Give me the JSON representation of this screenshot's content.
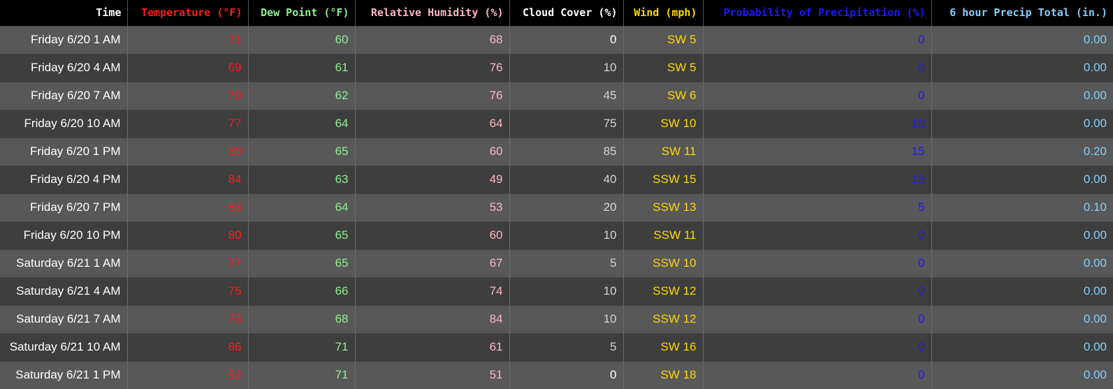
{
  "table": {
    "headers": {
      "time": "Time",
      "temperature": "Temperature (°F)",
      "dew_point": "Dew Point (°F)",
      "humidity": "Relative Humidity (%)",
      "cloud_cover": "Cloud Cover (%)",
      "wind": "Wind (mph)",
      "pop": "Probability of Precipitation (%)",
      "precip": "6 hour Precip Total (in.)"
    },
    "colors": {
      "time": "#ffffff",
      "temperature": "#ff1a1a",
      "dew_point": "#90ee90",
      "humidity": "#ffb6c1",
      "cloud_cover": "#d3d3d3",
      "wind": "#ffd700",
      "pop": "#1a1aff",
      "precip": "#87cefa"
    },
    "rows": [
      {
        "time": "Friday 6/20 1 AM",
        "temperature": "71",
        "dew_point": "60",
        "humidity": "68",
        "cloud_cover": "0",
        "wind": "SW 5",
        "pop": "0",
        "precip": "0.00"
      },
      {
        "time": "Friday 6/20 4 AM",
        "temperature": "69",
        "dew_point": "61",
        "humidity": "76",
        "cloud_cover": "10",
        "wind": "SW 5",
        "pop": "0",
        "precip": "0.00"
      },
      {
        "time": "Friday 6/20 7 AM",
        "temperature": "70",
        "dew_point": "62",
        "humidity": "76",
        "cloud_cover": "45",
        "wind": "SW 6",
        "pop": "0",
        "precip": "0.00"
      },
      {
        "time": "Friday 6/20 10 AM",
        "temperature": "77",
        "dew_point": "64",
        "humidity": "64",
        "cloud_cover": "75",
        "wind": "SW 10",
        "pop": "10",
        "precip": "0.00"
      },
      {
        "time": "Friday 6/20 1 PM",
        "temperature": "80",
        "dew_point": "65",
        "humidity": "60",
        "cloud_cover": "85",
        "wind": "SW 11",
        "pop": "15",
        "precip": "0.20"
      },
      {
        "time": "Friday 6/20 4 PM",
        "temperature": "84",
        "dew_point": "63",
        "humidity": "49",
        "cloud_cover": "40",
        "wind": "SSW 15",
        "pop": "18",
        "precip": "0.00"
      },
      {
        "time": "Friday 6/20 7 PM",
        "temperature": "83",
        "dew_point": "64",
        "humidity": "53",
        "cloud_cover": "20",
        "wind": "SSW 13",
        "pop": "5",
        "precip": "0.10"
      },
      {
        "time": "Friday 6/20 10 PM",
        "temperature": "80",
        "dew_point": "65",
        "humidity": "60",
        "cloud_cover": "10",
        "wind": "SSW 11",
        "pop": "0",
        "precip": "0.00"
      },
      {
        "time": "Saturday 6/21 1 AM",
        "temperature": "77",
        "dew_point": "65",
        "humidity": "67",
        "cloud_cover": "5",
        "wind": "SSW 10",
        "pop": "0",
        "precip": "0.00"
      },
      {
        "time": "Saturday 6/21 4 AM",
        "temperature": "75",
        "dew_point": "66",
        "humidity": "74",
        "cloud_cover": "10",
        "wind": "SSW 12",
        "pop": "0",
        "precip": "0.00"
      },
      {
        "time": "Saturday 6/21 7 AM",
        "temperature": "73",
        "dew_point": "68",
        "humidity": "84",
        "cloud_cover": "10",
        "wind": "SSW 12",
        "pop": "0",
        "precip": "0.00"
      },
      {
        "time": "Saturday 6/21 10 AM",
        "temperature": "86",
        "dew_point": "71",
        "humidity": "61",
        "cloud_cover": "5",
        "wind": "SW 16",
        "pop": "0",
        "precip": "0.00"
      },
      {
        "time": "Saturday 6/21 1 PM",
        "temperature": "92",
        "dew_point": "71",
        "humidity": "51",
        "cloud_cover": "0",
        "wind": "SW 18",
        "pop": "0",
        "precip": "0.00"
      }
    ]
  }
}
